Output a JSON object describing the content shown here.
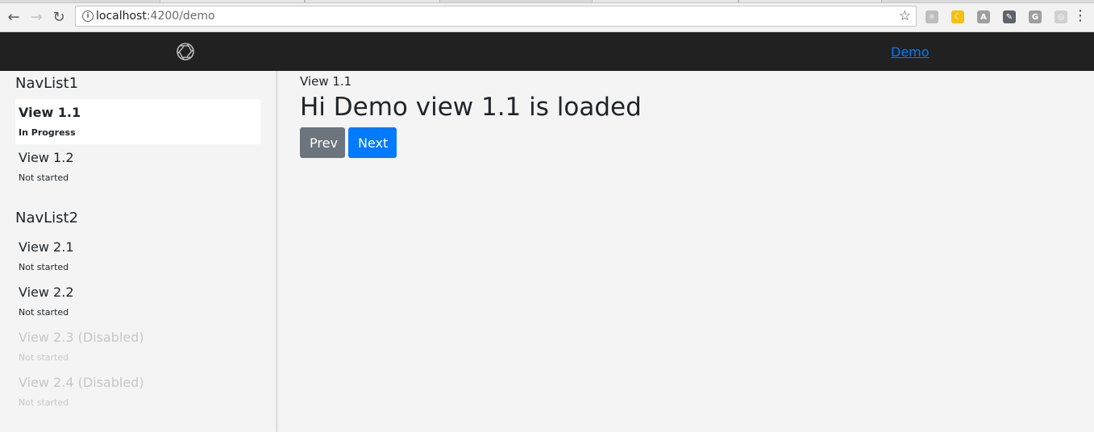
{
  "browser": {
    "url_host": "localhost",
    "url_path": ":4200/demo",
    "icons": {
      "back": "back-arrow-icon",
      "forward": "forward-arrow-icon",
      "reload": "reload-icon",
      "info": "info-icon",
      "bookmark": "star-icon",
      "menu": "kebab-menu-icon"
    },
    "extensions": [
      {
        "name": "react-devtools-icon",
        "glyph": "⚛",
        "color": "#bdbdbd"
      },
      {
        "name": "moon-extension-icon",
        "glyph": "☾",
        "color": "#f4c20d"
      },
      {
        "name": "pdf-extension-icon",
        "glyph": "A",
        "color": "#9e9e9e"
      },
      {
        "name": "note-extension-icon",
        "glyph": "✎",
        "color": "#5f6368"
      },
      {
        "name": "g-extension-icon",
        "glyph": "G",
        "color": "#9e9e9e"
      },
      {
        "name": "circle-extension-icon",
        "glyph": "◎",
        "color": "#cfcfcf"
      }
    ]
  },
  "navbar": {
    "logo": "aperture-logo-icon",
    "link": "Demo"
  },
  "sidebar": {
    "lists": [
      {
        "title": "NavList1",
        "items": [
          {
            "label": "View 1.1",
            "status": "In Progress",
            "state": "active"
          },
          {
            "label": "View 1.2",
            "status": "Not started",
            "state": "normal"
          }
        ]
      },
      {
        "title": "NavList2",
        "items": [
          {
            "label": "View 2.1",
            "status": "Not started",
            "state": "normal"
          },
          {
            "label": "View 2.2",
            "status": "Not started",
            "state": "normal"
          },
          {
            "label": "View 2.3 (Disabled)",
            "status": "Not started",
            "state": "disabled"
          },
          {
            "label": "View 2.4 (Disabled)",
            "status": "Not started",
            "state": "disabled"
          }
        ]
      }
    ]
  },
  "main": {
    "breadcrumb": "View 1.1",
    "title": "Hi Demo view 1.1 is loaded",
    "prev_label": "Prev",
    "next_label": "Next"
  },
  "colors": {
    "navbar_bg": "#212121",
    "page_bg": "#f4f4f4",
    "link": "#007bff",
    "prev_button": "#6c757d",
    "next_button": "#007bff"
  }
}
